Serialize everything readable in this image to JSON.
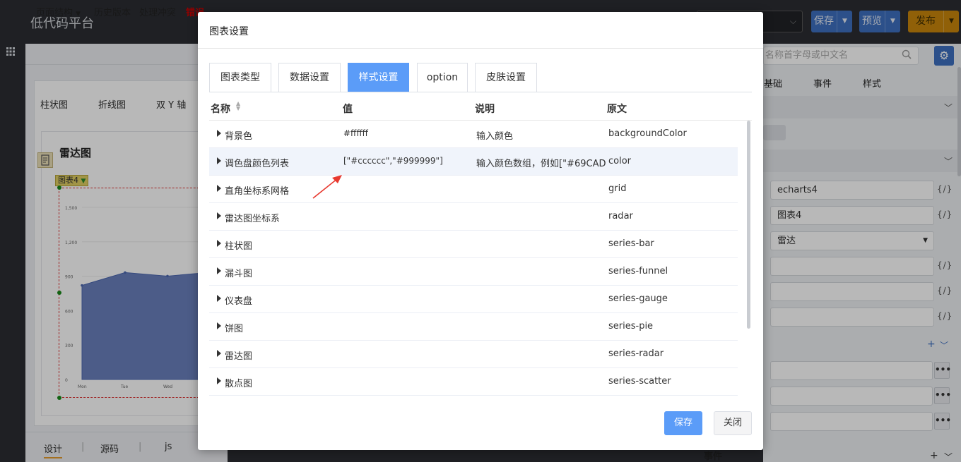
{
  "app": {
    "title": "低代码平台"
  },
  "topbar": {
    "save_label": "保存",
    "preview_label": "预览",
    "publish_label": "发布"
  },
  "toolbar": {
    "items": [
      "页面结构",
      "历史版本",
      "处理冲突",
      "错误"
    ]
  },
  "canvas": {
    "chart_types": [
      "柱状图",
      "折线图",
      "双 Y 轴"
    ],
    "radar_title": "雷达图",
    "chart_tag": "图表4",
    "mini_chart": {
      "categories": [
        "Mon",
        "Tue",
        "Wed"
      ],
      "values": [
        820,
        932,
        901,
        934
      ],
      "y_ticks": [
        "1,500",
        "1,200",
        "900",
        "600",
        "300",
        "0"
      ]
    }
  },
  "bottom_tabs": [
    "设计",
    "源码",
    "js"
  ],
  "right_panel": {
    "search_placeholder": "名称首字母或中文名",
    "tabs": [
      "基础",
      "事件",
      "样式"
    ],
    "fields": [
      "echarts4",
      "图表4",
      "雷达"
    ],
    "code_icon": "{/}",
    "dots": "•••",
    "plus": "+",
    "event_label": "事件"
  },
  "dialog": {
    "title": "图表设置",
    "tabs": [
      "图表类型",
      "数据设置",
      "样式设置",
      "option",
      "皮肤设置"
    ],
    "active_tab": "样式设置",
    "columns": [
      "名称",
      "值",
      "说明",
      "原文"
    ],
    "rows": [
      {
        "name": "背景色",
        "value": "#ffffff",
        "desc": "输入颜色",
        "orig": "backgroundColor"
      },
      {
        "name": "调色盘颜色列表",
        "value": "[\"#cccccc\",\"#999999\"]",
        "desc": "输入颜色数组，例如[\"#69CAD",
        "orig": "color"
      },
      {
        "name": "直角坐标系网格",
        "value": "",
        "desc": "",
        "orig": "grid"
      },
      {
        "name": "雷达图坐标系",
        "value": "",
        "desc": "",
        "orig": "radar"
      },
      {
        "name": "柱状图",
        "value": "",
        "desc": "",
        "orig": "series-bar"
      },
      {
        "name": "漏斗图",
        "value": "",
        "desc": "",
        "orig": "series-funnel"
      },
      {
        "name": "仪表盘",
        "value": "",
        "desc": "",
        "orig": "series-gauge"
      },
      {
        "name": "饼图",
        "value": "",
        "desc": "",
        "orig": "series-pie"
      },
      {
        "name": "雷达图",
        "value": "",
        "desc": "",
        "orig": "series-radar"
      },
      {
        "name": "散点图",
        "value": "",
        "desc": "",
        "orig": "series-scatter"
      }
    ],
    "save_label": "保存",
    "close_label": "关闭"
  },
  "colors": {
    "accent": "#5b9cf8",
    "top_blue": "#3d6fc0",
    "publish": "#c8860c",
    "annotation": "#e8392f",
    "chart_fill": "#6a80bd"
  }
}
